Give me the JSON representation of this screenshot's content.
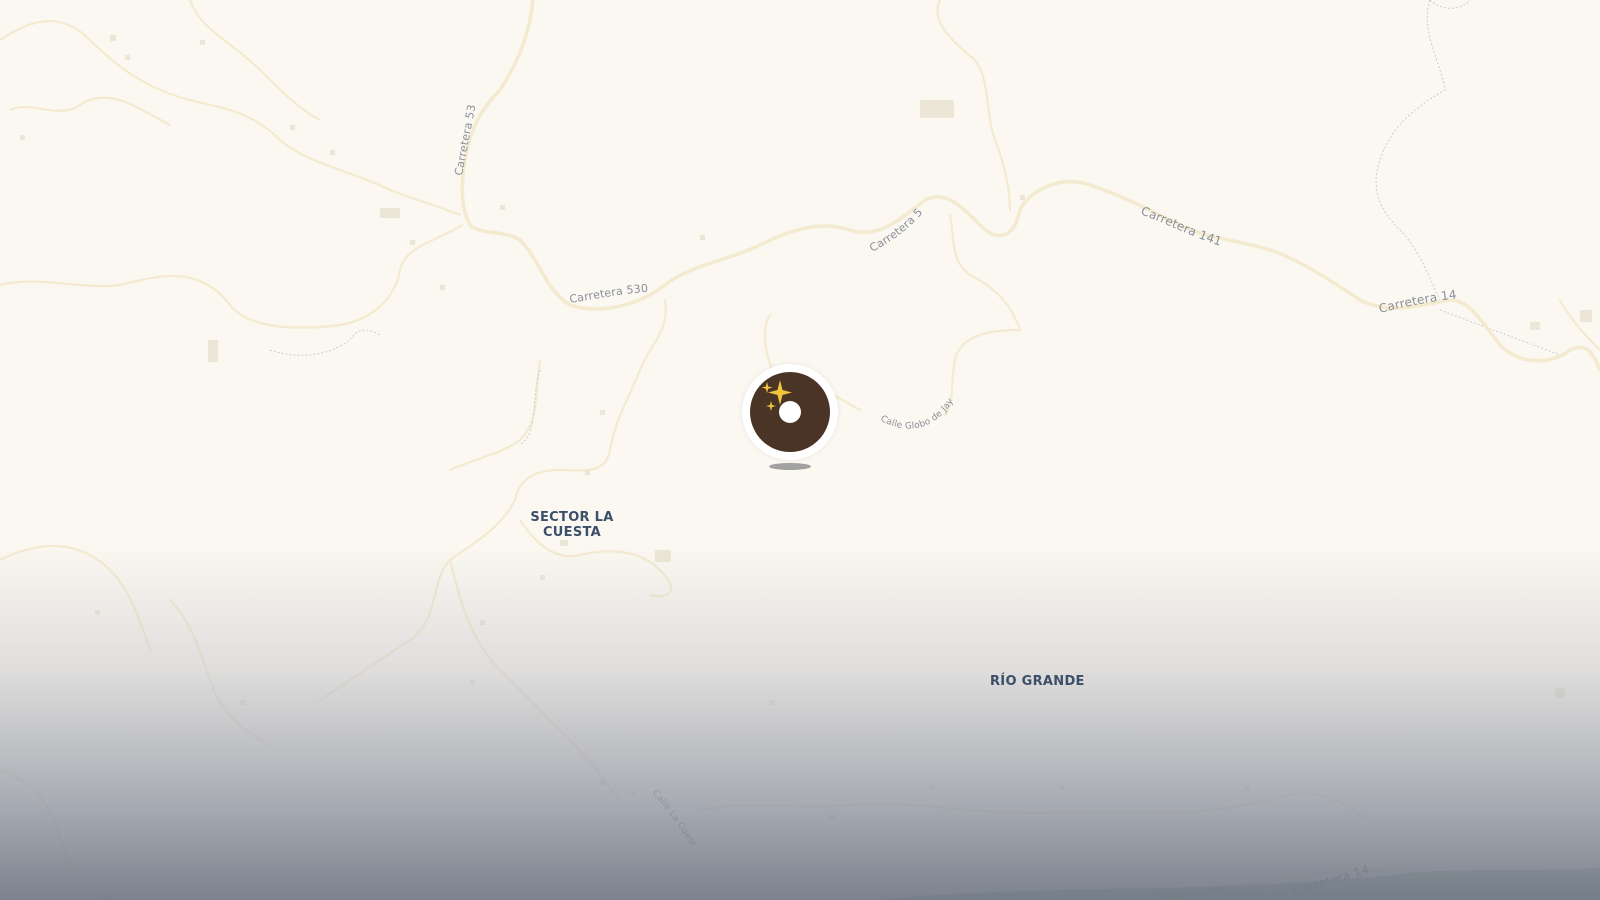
{
  "map": {
    "roads": {
      "carretera_530_a": "Carretera 530",
      "carretera_530_b": "Carretera 530",
      "carretera_530_c": "Carretera 530",
      "carretera_141_a": "Carretera 141",
      "carretera_141_b": "Carretera 141",
      "carretera_141_c": "Carretera 141",
      "calle_globo": "Calle Globo de Jayuya",
      "calle_la_cuesta": "Calle La Cuesta"
    },
    "places": {
      "sector_la_cuesta": "SECTOR LA CUESTA",
      "rio_grande": "RÍO GRANDE"
    },
    "marker": {
      "icon": "donut-sparkles-icon",
      "donut_color": "#4a3426",
      "sparkle_color": "#f2c53d"
    },
    "colors": {
      "background": "#fbf8f1",
      "road": "#f5ecd2",
      "place_label": "#3b4f6b",
      "road_label": "#8a8f99"
    }
  }
}
